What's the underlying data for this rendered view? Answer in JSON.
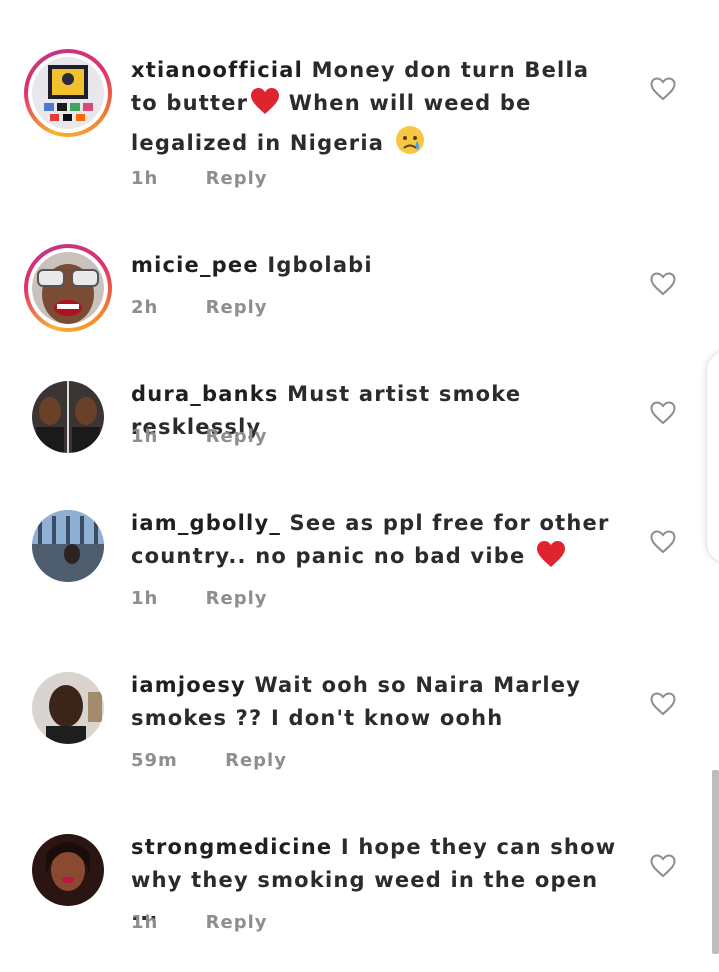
{
  "comments": [
    {
      "username": "xtianoofficial",
      "text": "Money don turn Bella to butter",
      "text2": "When will weed be legalized in Nigeria",
      "time": "1h",
      "reply": "Reply"
    },
    {
      "username": "micie_pee",
      "text": "Igbolabi",
      "time": "2h",
      "reply": "Reply"
    },
    {
      "username": "dura_banks",
      "text": "Must artist smoke resklessly",
      "time": "1h",
      "reply": "Reply"
    },
    {
      "username": "iam_gbolly_",
      "text": "See as ppl free for other country.. no panic no bad vibe",
      "time": "1h",
      "reply": "Reply"
    },
    {
      "username": "iamjoesy",
      "text": "Wait ooh so Naira Marley smokes ?? I don't know oohh",
      "time": "59m",
      "reply": "Reply"
    },
    {
      "username": "strongmedicine",
      "text": "I hope they can show why they smoking weed in the open ...",
      "time": "1h",
      "reply": "Reply"
    }
  ],
  "colors": {
    "meta_gray": "#8e8e8e",
    "heart_red": "#e0242f",
    "story_ring": "#e1306c"
  },
  "icons": {
    "like": "heart-outline-icon",
    "emoji_heart": "red-heart-emoji",
    "emoji_cry": "crying-face-emoji"
  }
}
